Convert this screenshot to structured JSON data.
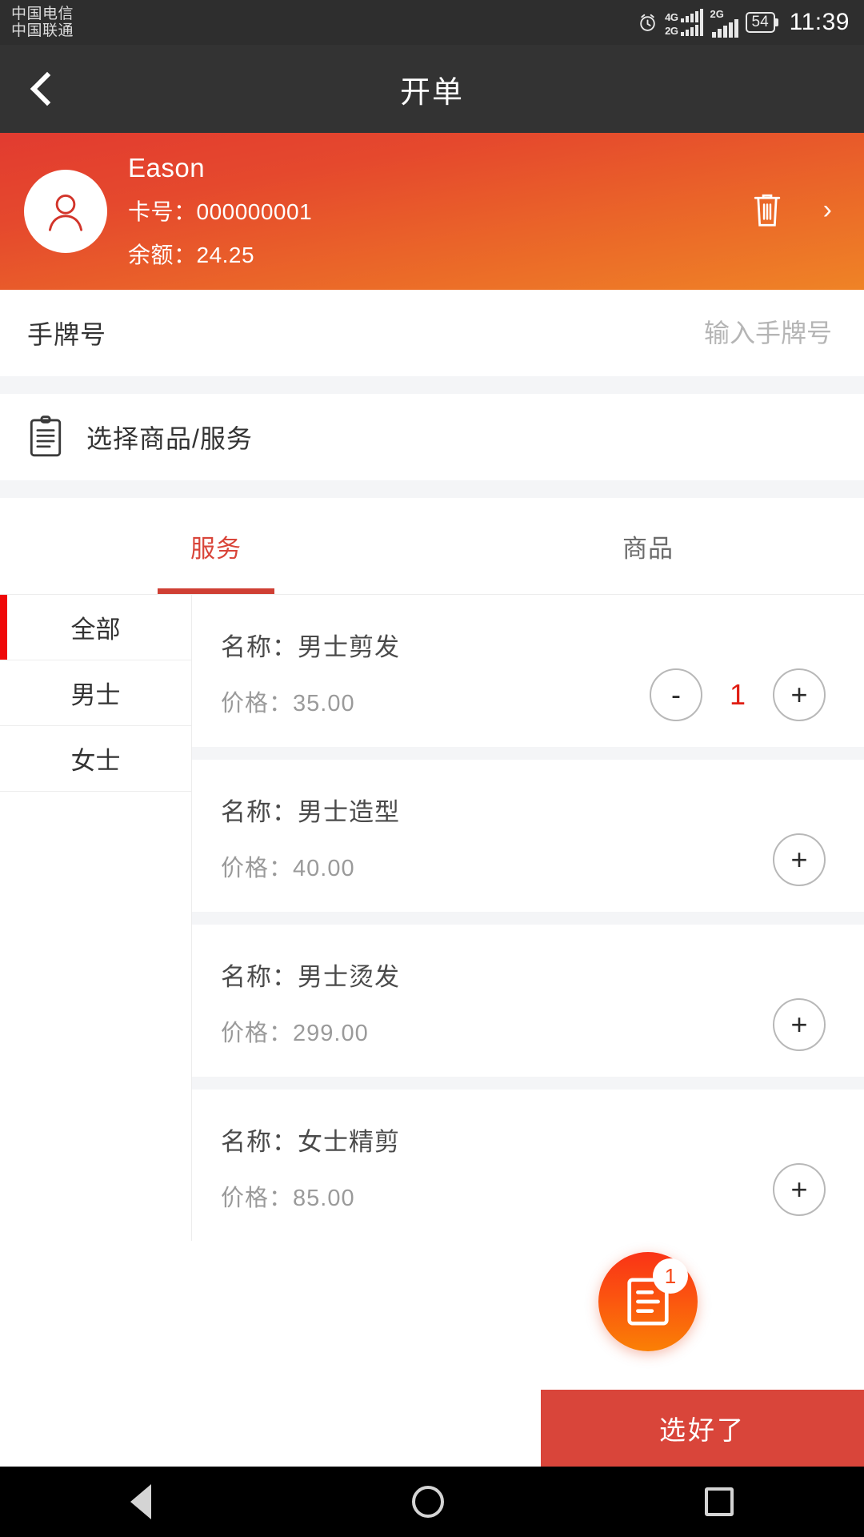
{
  "status_bar": {
    "carriers": [
      "中国电信",
      "中国联通"
    ],
    "alarm_icon": "alarm-icon",
    "network_primary": {
      "label_top": "4G",
      "label_bottom": "2G"
    },
    "network_secondary": {
      "label": "2G"
    },
    "battery_level": "54",
    "time": "11:39"
  },
  "title_bar": {
    "back_icon": "back-chevron-icon",
    "title": "开单"
  },
  "member_card": {
    "avatar_icon": "person-avatar-icon",
    "name": "Eason",
    "card_no_label": "卡号：",
    "card_no": "000000001",
    "card_no_full": "卡号：000000001",
    "balance_label": "余额：",
    "balance": "24.25",
    "balance_full": "余额：24.25",
    "delete_icon": "trash-icon",
    "detail_arrow": "›",
    "gradient_start": "#e23b30",
    "gradient_end": "#ef8326"
  },
  "hand_plate": {
    "label": "手牌号",
    "placeholder": "输入手牌号",
    "value": ""
  },
  "select_section": {
    "icon": "clipboard-list-icon",
    "label": "选择商品/服务"
  },
  "tabs": [
    {
      "label": "服务",
      "active": true
    },
    {
      "label": "商品",
      "active": false
    }
  ],
  "categories": [
    {
      "label": "全部",
      "active": true
    },
    {
      "label": "男士",
      "active": false
    },
    {
      "label": "女士",
      "active": false
    }
  ],
  "items": [
    {
      "name_label": "名称：",
      "name": "男士剪发",
      "name_full": "名称：男士剪发",
      "price_label": "价格：",
      "price": "35.00",
      "price_full": "价格：35.00",
      "quantity": "1",
      "has_minus": true
    },
    {
      "name_label": "名称：",
      "name": "男士造型",
      "name_full": "名称：男士造型",
      "price_label": "价格：",
      "price": "40.00",
      "price_full": "价格：40.00",
      "quantity": "0",
      "has_minus": false
    },
    {
      "name_label": "名称：",
      "name": "男士烫发",
      "name_full": "名称：男士烫发",
      "price_label": "价格：",
      "price": "299.00",
      "price_full": "价格：299.00",
      "quantity": "0",
      "has_minus": false
    },
    {
      "name_label": "名称：",
      "name": "女士精剪",
      "name_full": "名称：女士精剪",
      "price_label": "价格：",
      "price": "85.00",
      "price_full": "价格：85.00",
      "quantity": "0",
      "has_minus": false
    }
  ],
  "stepper": {
    "minus": "-",
    "plus": "+"
  },
  "cart_fab": {
    "icon": "order-document-icon",
    "badge_count": "1",
    "gradient_start": "#fa3316",
    "gradient_end": "#fa8005"
  },
  "confirm_button": {
    "label": "选好了",
    "color": "#d9453a"
  },
  "nav_bar": {
    "back_icon": "nav-back-triangle-icon",
    "home_icon": "nav-home-circle-icon",
    "recents_icon": "nav-recents-square-icon"
  }
}
